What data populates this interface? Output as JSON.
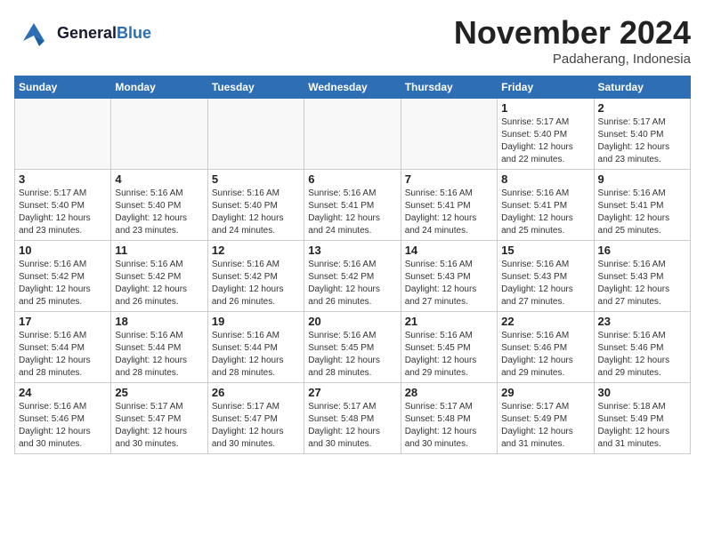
{
  "header": {
    "logo_general": "General",
    "logo_blue": "Blue",
    "month_title": "November 2024",
    "location": "Padaherang, Indonesia"
  },
  "calendar": {
    "days_of_week": [
      "Sunday",
      "Monday",
      "Tuesday",
      "Wednesday",
      "Thursday",
      "Friday",
      "Saturday"
    ],
    "weeks": [
      [
        {
          "day": "",
          "info": ""
        },
        {
          "day": "",
          "info": ""
        },
        {
          "day": "",
          "info": ""
        },
        {
          "day": "",
          "info": ""
        },
        {
          "day": "",
          "info": ""
        },
        {
          "day": "1",
          "info": "Sunrise: 5:17 AM\nSunset: 5:40 PM\nDaylight: 12 hours\nand 22 minutes."
        },
        {
          "day": "2",
          "info": "Sunrise: 5:17 AM\nSunset: 5:40 PM\nDaylight: 12 hours\nand 23 minutes."
        }
      ],
      [
        {
          "day": "3",
          "info": "Sunrise: 5:17 AM\nSunset: 5:40 PM\nDaylight: 12 hours\nand 23 minutes."
        },
        {
          "day": "4",
          "info": "Sunrise: 5:16 AM\nSunset: 5:40 PM\nDaylight: 12 hours\nand 23 minutes."
        },
        {
          "day": "5",
          "info": "Sunrise: 5:16 AM\nSunset: 5:40 PM\nDaylight: 12 hours\nand 24 minutes."
        },
        {
          "day": "6",
          "info": "Sunrise: 5:16 AM\nSunset: 5:41 PM\nDaylight: 12 hours\nand 24 minutes."
        },
        {
          "day": "7",
          "info": "Sunrise: 5:16 AM\nSunset: 5:41 PM\nDaylight: 12 hours\nand 24 minutes."
        },
        {
          "day": "8",
          "info": "Sunrise: 5:16 AM\nSunset: 5:41 PM\nDaylight: 12 hours\nand 25 minutes."
        },
        {
          "day": "9",
          "info": "Sunrise: 5:16 AM\nSunset: 5:41 PM\nDaylight: 12 hours\nand 25 minutes."
        }
      ],
      [
        {
          "day": "10",
          "info": "Sunrise: 5:16 AM\nSunset: 5:42 PM\nDaylight: 12 hours\nand 25 minutes."
        },
        {
          "day": "11",
          "info": "Sunrise: 5:16 AM\nSunset: 5:42 PM\nDaylight: 12 hours\nand 26 minutes."
        },
        {
          "day": "12",
          "info": "Sunrise: 5:16 AM\nSunset: 5:42 PM\nDaylight: 12 hours\nand 26 minutes."
        },
        {
          "day": "13",
          "info": "Sunrise: 5:16 AM\nSunset: 5:42 PM\nDaylight: 12 hours\nand 26 minutes."
        },
        {
          "day": "14",
          "info": "Sunrise: 5:16 AM\nSunset: 5:43 PM\nDaylight: 12 hours\nand 27 minutes."
        },
        {
          "day": "15",
          "info": "Sunrise: 5:16 AM\nSunset: 5:43 PM\nDaylight: 12 hours\nand 27 minutes."
        },
        {
          "day": "16",
          "info": "Sunrise: 5:16 AM\nSunset: 5:43 PM\nDaylight: 12 hours\nand 27 minutes."
        }
      ],
      [
        {
          "day": "17",
          "info": "Sunrise: 5:16 AM\nSunset: 5:44 PM\nDaylight: 12 hours\nand 28 minutes."
        },
        {
          "day": "18",
          "info": "Sunrise: 5:16 AM\nSunset: 5:44 PM\nDaylight: 12 hours\nand 28 minutes."
        },
        {
          "day": "19",
          "info": "Sunrise: 5:16 AM\nSunset: 5:44 PM\nDaylight: 12 hours\nand 28 minutes."
        },
        {
          "day": "20",
          "info": "Sunrise: 5:16 AM\nSunset: 5:45 PM\nDaylight: 12 hours\nand 28 minutes."
        },
        {
          "day": "21",
          "info": "Sunrise: 5:16 AM\nSunset: 5:45 PM\nDaylight: 12 hours\nand 29 minutes."
        },
        {
          "day": "22",
          "info": "Sunrise: 5:16 AM\nSunset: 5:46 PM\nDaylight: 12 hours\nand 29 minutes."
        },
        {
          "day": "23",
          "info": "Sunrise: 5:16 AM\nSunset: 5:46 PM\nDaylight: 12 hours\nand 29 minutes."
        }
      ],
      [
        {
          "day": "24",
          "info": "Sunrise: 5:16 AM\nSunset: 5:46 PM\nDaylight: 12 hours\nand 30 minutes."
        },
        {
          "day": "25",
          "info": "Sunrise: 5:17 AM\nSunset: 5:47 PM\nDaylight: 12 hours\nand 30 minutes."
        },
        {
          "day": "26",
          "info": "Sunrise: 5:17 AM\nSunset: 5:47 PM\nDaylight: 12 hours\nand 30 minutes."
        },
        {
          "day": "27",
          "info": "Sunrise: 5:17 AM\nSunset: 5:48 PM\nDaylight: 12 hours\nand 30 minutes."
        },
        {
          "day": "28",
          "info": "Sunrise: 5:17 AM\nSunset: 5:48 PM\nDaylight: 12 hours\nand 30 minutes."
        },
        {
          "day": "29",
          "info": "Sunrise: 5:17 AM\nSunset: 5:49 PM\nDaylight: 12 hours\nand 31 minutes."
        },
        {
          "day": "30",
          "info": "Sunrise: 5:18 AM\nSunset: 5:49 PM\nDaylight: 12 hours\nand 31 minutes."
        }
      ]
    ]
  }
}
